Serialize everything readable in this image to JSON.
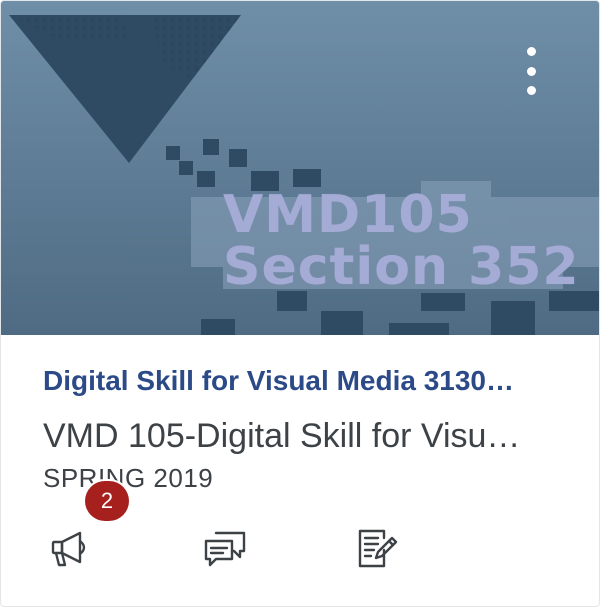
{
  "card": {
    "hero_line1": "VMD105",
    "hero_line2": "Section 352",
    "title": "Digital Skill for Visual Media 3130…",
    "subtitle": "VMD 105-Digital Skill for Visu…",
    "term": "SPRING 2019",
    "announcements_badge": "2"
  },
  "icons": {
    "menu": "more-vertical-icon",
    "announcements": "megaphone-icon",
    "discussions": "discussion-icon",
    "assignments": "assignment-icon"
  },
  "colors": {
    "title": "#2b4a87",
    "badge": "#a6201e",
    "hero": "#5d7b94"
  }
}
